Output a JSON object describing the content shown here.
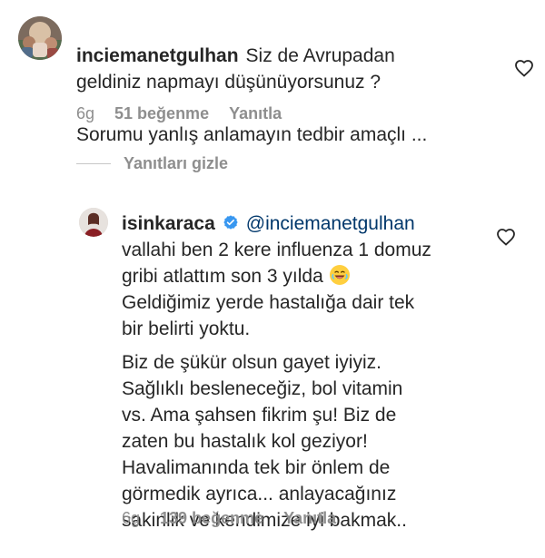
{
  "comments": {
    "main": {
      "username": "inciemanetgulhan",
      "text_lines": [
        "Siz de Avrupadan",
        "geldiniz napmayı düşünüyorsunuz ?",
        "Sorumu yanlış anlamayın tedbir amaçlı ..."
      ],
      "meta": {
        "time": "6g",
        "likes": "51 beğenme",
        "reply": "Yanıtla"
      },
      "avatar_icon": "profile-photo-icon"
    },
    "hide_replies": {
      "label": "Yanıtları gizle"
    },
    "reply": {
      "username": "isinkaraca",
      "verified_icon": "verified-badge-icon",
      "mention": "@inciemanetgulhan",
      "lines": [
        "vallahi ben 2 kere influenza 1 domuz",
        "gribi atlattım son 3 yılda",
        "Geldiğimiz yerde hastalığa dair tek",
        "bir belirti yoktu.",
        "Biz de şükür olsun gayet iyiyiz.",
        "Sağlıklı besleneceğiz, bol vitamin",
        "vs. Ama şahsen fikrim şu! Biz de",
        "zaten bu hastalık kol geziyor!",
        "Havalimanında tek bir önlem de",
        "görmedik ayrıca... anlayacağınız",
        "sakinlik ve kendimize iyi bakmak.."
      ],
      "emoji_icon": "laughing-face-emoji",
      "meta": {
        "time": "6g",
        "likes": "139 beğenme",
        "reply": "Yanıtla"
      },
      "avatar_icon": "profile-photo-icon"
    }
  },
  "icons": {
    "heart_main": "heart-outline-icon",
    "heart_reply": "heart-outline-icon"
  },
  "colors": {
    "text": "#262626",
    "muted": "#8e8e8e",
    "mention": "#00376b",
    "verified": "#3897f0"
  }
}
